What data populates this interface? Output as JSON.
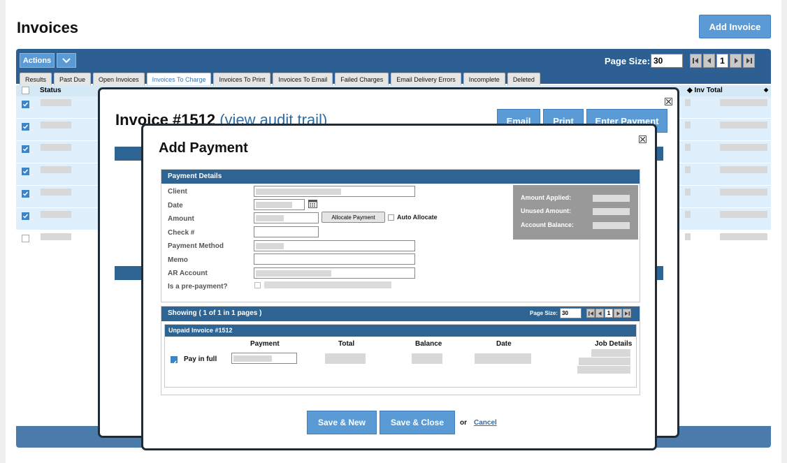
{
  "page": {
    "title": "Invoices",
    "add_invoice_label": "Add Invoice"
  },
  "toolbar": {
    "actions_label": "Actions",
    "page_size_label": "Page Size:",
    "page_size_value": "30",
    "current_page": "1"
  },
  "tabs": [
    {
      "label": "Results"
    },
    {
      "label": "Past Due"
    },
    {
      "label": "Open Invoices"
    },
    {
      "label": "Invoices To Charge",
      "active": true
    },
    {
      "label": "Invoices To Print"
    },
    {
      "label": "Invoices To Email"
    },
    {
      "label": "Failed Charges"
    },
    {
      "label": "Email Delivery Errors"
    },
    {
      "label": "Incomplete"
    },
    {
      "label": "Deleted"
    }
  ],
  "grid": {
    "status_header": "Status",
    "inv_total_header": "Inv Total",
    "rows_checked": [
      true,
      true,
      true,
      true,
      true,
      true,
      false
    ]
  },
  "invoice_modal": {
    "title": "Invoice #1512",
    "audit_link": "(view audit trail)",
    "email_label": "Email",
    "print_label": "Print",
    "enter_payment_label": "Enter Payment"
  },
  "payment_modal": {
    "title": "Add Payment",
    "details_header": "Payment Details",
    "labels": {
      "client": "Client",
      "date": "Date",
      "amount": "Amount",
      "check": "Check #",
      "method": "Payment Method",
      "memo": "Memo",
      "ar_account": "AR Account",
      "prepayment": "Is a pre-payment?"
    },
    "allocate_label": "Allocate Payment",
    "auto_allocate_label": "Auto Allocate",
    "summary": {
      "applied": "Amount Applied:",
      "unused": "Unused Amount:",
      "balance": "Account Balance:"
    },
    "showing_text": "Showing ( 1 of 1 in 1 pages )",
    "page_size_label": "Page Size:",
    "page_size_value": "30",
    "current_page": "1",
    "unpaid_header": "Unpaid Invoice #1512",
    "columns": {
      "payment": "Payment",
      "total": "Total",
      "balance": "Balance",
      "date": "Date",
      "job_details": "Job Details"
    },
    "pay_in_full_label": "Pay in full",
    "save_new_label": "Save & New",
    "save_close_label": "Save & Close",
    "or_label": "or",
    "cancel_label": "Cancel"
  },
  "colors": {
    "primary_button": "#5b9bd5",
    "header_bar": "#2d6494",
    "toolbar": "#2d5f92",
    "link": "#2e6ca8"
  }
}
